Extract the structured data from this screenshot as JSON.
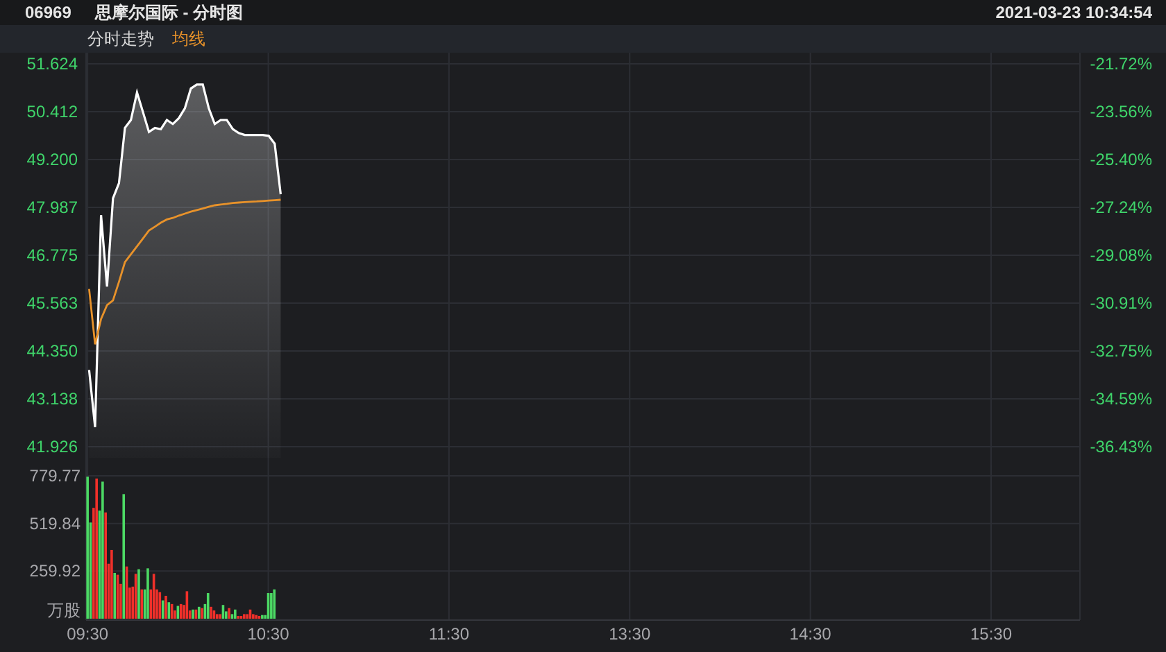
{
  "header": {
    "code": "06969",
    "name": "思摩尔国际 - 分时图",
    "datetime": "2021-03-23 10:34:54"
  },
  "legend": [
    {
      "label": "分时走势",
      "color": "#d8d8d8"
    },
    {
      "label": "均线",
      "color": "#e8922a"
    }
  ],
  "price_chart": {
    "chart_data": {
      "type": "line",
      "grid": true,
      "ylim": [
        41.926,
        51.624
      ],
      "categories": [
        null,
        null,
        null,
        null,
        null,
        null,
        null,
        null,
        null,
        null,
        null,
        null,
        null,
        null,
        null,
        null,
        null,
        null,
        null,
        null,
        null,
        null,
        null,
        null,
        null,
        null,
        null,
        null,
        null,
        null,
        null,
        null,
        null,
        null,
        null,
        null,
        null,
        null,
        null,
        null,
        null,
        null,
        null,
        null,
        null,
        null,
        null,
        null,
        null,
        null,
        null,
        null,
        null,
        null,
        null,
        null,
        null,
        null,
        null,
        null,
        null,
        null,
        null,
        null,
        null,
        null,
        null,
        null,
        null,
        null,
        null,
        null,
        null,
        null,
        null,
        null,
        null,
        null,
        null,
        null,
        null,
        null,
        null,
        null,
        null,
        null,
        null,
        null,
        null,
        null,
        null,
        null,
        null,
        null,
        null,
        null,
        null,
        null,
        null,
        null,
        null,
        null,
        null,
        null,
        null,
        null,
        null,
        null,
        null,
        null,
        null,
        null,
        null,
        null,
        null,
        null,
        null,
        null,
        null,
        null,
        null,
        null,
        null,
        null,
        null,
        null,
        null,
        null,
        null,
        null,
        null,
        null,
        null,
        null,
        null,
        null,
        null,
        null,
        null,
        null,
        null,
        null,
        null,
        null,
        null,
        null,
        null,
        null,
        null,
        null,
        null,
        null,
        null,
        null,
        null,
        null,
        null,
        null,
        null,
        null,
        null,
        null,
        null,
        null,
        null,
        null
      ],
      "yticks": [
        {
          "value": 41.926,
          "label": "41.926"
        },
        {
          "value": 43.138,
          "label": "43.138"
        },
        {
          "value": 44.35,
          "label": "44.350"
        },
        {
          "value": 45.563,
          "label": "45.563"
        },
        {
          "value": 46.775,
          "label": "46.775"
        },
        {
          "value": 47.987,
          "label": "47.987"
        },
        {
          "value": 49.2,
          "label": "49.200"
        },
        {
          "value": 50.412,
          "label": "50.412"
        },
        {
          "value": 51.624,
          "label": "51.624"
        }
      ],
      "series": [
        {
          "color": "#ffffff",
          "values": [
            43.87,
            42.42,
            47.79,
            45.98,
            48.22,
            48.6,
            50.0,
            50.2,
            50.9,
            50.4,
            49.9,
            50.0,
            49.97,
            50.2,
            50.1,
            50.25,
            50.5,
            51.0,
            51.1,
            51.1,
            50.5,
            50.1,
            50.2,
            50.2,
            49.97,
            49.87,
            49.82,
            49.82,
            49.82,
            49.82,
            49.8,
            49.6,
            48.32,
            null,
            null,
            null,
            null,
            null,
            null,
            null,
            null,
            null,
            null,
            null,
            null,
            null,
            null,
            null,
            null,
            null,
            null,
            null,
            null,
            null,
            null,
            null,
            null,
            null,
            null,
            null,
            null,
            null,
            null,
            null,
            null,
            null,
            null,
            null,
            null,
            null,
            null,
            null,
            null,
            null,
            null,
            null,
            null,
            null,
            null,
            null,
            null,
            null,
            null,
            null,
            null,
            null,
            null,
            null,
            null,
            null,
            null,
            null,
            null,
            null,
            null,
            null,
            null,
            null,
            null,
            null,
            null,
            null,
            null,
            null,
            null,
            null,
            null,
            null,
            null,
            null,
            null,
            null,
            null,
            null,
            null,
            null,
            null,
            null,
            null,
            null,
            null,
            null,
            null,
            null,
            null,
            null,
            null,
            null,
            null,
            null,
            null,
            null,
            null,
            null,
            null,
            null,
            null,
            null,
            null,
            null,
            null,
            null,
            null,
            null,
            null,
            null,
            null,
            null,
            null,
            null,
            null,
            null,
            null,
            null,
            null,
            null,
            null,
            null,
            null,
            null,
            null,
            null,
            null,
            null,
            null,
            null
          ]
        },
        {
          "color": "#e8922a",
          "values": [
            45.92,
            44.52,
            45.16,
            45.51,
            45.63,
            46.1,
            46.6,
            46.8,
            47.0,
            47.2,
            47.4,
            47.5,
            47.6,
            47.68,
            47.72,
            47.78,
            47.83,
            47.88,
            47.92,
            47.96,
            48.0,
            48.04,
            48.06,
            48.08,
            48.1,
            48.11,
            48.12,
            48.13,
            48.14,
            48.15,
            48.16,
            48.17,
            48.18,
            null,
            null,
            null,
            null,
            null,
            null,
            null,
            null,
            null,
            null,
            null,
            null,
            null,
            null,
            null,
            null,
            null,
            null,
            null,
            null,
            null,
            null,
            null,
            null,
            null,
            null,
            null,
            null,
            null,
            null,
            null,
            null,
            null,
            null,
            null,
            null,
            null,
            null,
            null,
            null,
            null,
            null,
            null,
            null,
            null,
            null,
            null,
            null,
            null,
            null,
            null,
            null,
            null,
            null,
            null,
            null,
            null,
            null,
            null,
            null,
            null,
            null,
            null,
            null,
            null,
            null,
            null,
            null,
            null,
            null,
            null,
            null,
            null,
            null,
            null,
            null,
            null,
            null,
            null,
            null,
            null,
            null,
            null,
            null,
            null,
            null,
            null,
            null,
            null,
            null,
            null,
            null,
            null,
            null,
            null,
            null,
            null,
            null,
            null,
            null,
            null,
            null,
            null,
            null,
            null,
            null,
            null,
            null,
            null,
            null,
            null,
            null,
            null,
            null,
            null,
            null,
            null,
            null,
            null,
            null,
            null,
            null,
            null,
            null,
            null,
            null,
            null,
            null,
            null,
            null,
            null,
            null,
            null
          ]
        }
      ]
    },
    "percent_labels": [
      "-21.72%",
      "-23.56%",
      "-25.40%",
      "-27.24%",
      "-29.08%",
      "-30.91%",
      "-32.75%",
      "-34.59%",
      "-36.43%"
    ]
  },
  "volume_chart": {
    "chart_data": {
      "type": "bar",
      "grid": true,
      "ylim": [
        0,
        779.77
      ],
      "yticks": [
        259.92,
        519.84,
        779.77
      ],
      "categories": [
        "09:30",
        null,
        null,
        null,
        null,
        null,
        null,
        null,
        null,
        null,
        null,
        null,
        null,
        null,
        null,
        null,
        null,
        null,
        null,
        null,
        null,
        null,
        null,
        null,
        null,
        null,
        null,
        null,
        null,
        null,
        null,
        null,
        null,
        null,
        null,
        null,
        null,
        null,
        null,
        null,
        null,
        null,
        null,
        null,
        null,
        null,
        null,
        null,
        null,
        null,
        null,
        null,
        null,
        null,
        null,
        null,
        null,
        null,
        null,
        null,
        "10:30",
        null,
        null,
        null,
        null,
        null,
        null,
        null,
        null,
        null,
        null,
        null,
        null,
        null,
        null,
        null,
        null,
        null,
        null,
        null,
        null,
        null,
        null,
        null,
        null,
        null,
        null,
        null,
        null,
        null,
        null,
        null,
        null,
        null,
        null,
        null,
        null,
        null,
        null,
        null,
        null,
        null,
        null,
        null,
        null,
        null,
        null,
        null,
        null,
        null,
        null,
        null,
        null,
        null,
        null,
        null,
        null,
        null,
        null,
        null,
        "11:30",
        null,
        null,
        null,
        null,
        null,
        null,
        null,
        null,
        null,
        null,
        null,
        null,
        null,
        null,
        null,
        null,
        null,
        null,
        null,
        null,
        null,
        null,
        null,
        null,
        null,
        null,
        null,
        null,
        null,
        null,
        null,
        null,
        null,
        null,
        null,
        null,
        null,
        null,
        null,
        null,
        null,
        null,
        null,
        null,
        null,
        null,
        null,
        null,
        null,
        null,
        null,
        null,
        null,
        null,
        null,
        null,
        null,
        null,
        null,
        "13:30",
        null,
        null,
        null,
        null,
        null,
        null,
        null,
        null,
        null,
        null,
        null,
        null,
        null,
        null,
        null,
        null,
        null,
        null,
        null,
        null,
        null,
        null,
        null,
        null,
        null,
        null,
        null,
        null,
        null,
        null,
        null,
        null,
        null,
        null,
        null,
        null,
        null,
        null,
        null,
        null,
        null,
        null,
        null,
        null,
        null,
        null,
        null,
        null,
        null,
        null,
        null,
        null,
        null,
        null,
        null,
        null,
        null,
        null,
        null,
        "14:30",
        null,
        null,
        null,
        null,
        null,
        null,
        null,
        null,
        null,
        null,
        null,
        null,
        null,
        null,
        null,
        null,
        null,
        null,
        null,
        null,
        null,
        null,
        null,
        null,
        null,
        null,
        null,
        null,
        null,
        null,
        null,
        null,
        null,
        null,
        null,
        null,
        null,
        null,
        null,
        null,
        null,
        null,
        null,
        null,
        null,
        null,
        null,
        null,
        null,
        null,
        null,
        null,
        null,
        null,
        null,
        null,
        null,
        null,
        null,
        "15:30",
        null,
        null,
        null,
        null,
        null,
        null,
        null,
        null,
        null,
        null,
        null,
        null,
        null,
        null,
        null,
        null,
        null,
        null,
        null,
        null,
        null,
        null,
        null,
        null,
        null,
        null,
        null,
        null,
        null
      ],
      "series": [
        {
          "color": "#4cd964",
          "values": [
            775,
            525,
            null,
            null,
            590,
            748,
            null,
            null,
            null,
            250,
            null,
            null,
            680,
            null,
            null,
            null,
            null,
            270,
            null,
            160,
            275,
            null,
            null,
            null,
            null,
            100,
            null,
            90,
            null,
            null,
            70,
            null,
            null,
            null,
            null,
            50,
            null,
            65,
            null,
            80,
            140,
            null,
            null,
            null,
            null,
            75,
            40,
            null,
            25,
            50,
            null,
            null,
            null,
            null,
            null,
            null,
            null,
            null,
            20,
            20,
            140,
            140,
            160,
            null,
            null,
            null,
            null,
            null,
            null,
            null,
            null,
            null,
            null,
            null,
            null,
            null,
            null,
            null,
            null,
            null,
            null,
            null,
            null,
            null,
            null,
            null,
            null,
            null,
            null,
            null,
            null,
            null,
            null,
            null,
            null,
            null,
            null,
            null,
            null,
            null,
            null,
            null,
            null,
            null,
            null,
            null,
            null,
            null,
            null,
            null,
            null,
            null,
            null,
            null,
            null,
            null,
            null,
            null,
            null,
            null,
            null,
            null,
            null,
            null,
            null,
            null,
            null,
            null,
            null,
            null,
            null,
            null,
            null,
            null,
            null,
            null,
            null,
            null,
            null,
            null,
            null,
            null,
            null,
            null,
            null,
            null,
            null,
            null,
            null,
            null,
            null,
            null,
            null,
            null,
            null,
            null,
            null,
            null,
            null,
            null,
            null,
            null,
            null,
            null,
            null,
            null,
            null,
            null,
            null,
            null,
            null,
            null,
            null,
            null,
            null,
            null,
            null,
            null,
            null,
            null,
            null,
            null,
            null,
            null,
            null,
            null,
            null,
            null,
            null,
            null,
            null,
            null,
            null,
            null,
            null,
            null,
            null,
            null,
            null,
            null,
            null,
            null,
            null,
            null,
            null,
            null,
            null,
            null,
            null,
            null,
            null,
            null,
            null,
            null,
            null,
            null,
            null,
            null,
            null,
            null,
            null,
            null,
            null,
            null,
            null,
            null,
            null,
            null,
            null,
            null,
            null,
            null,
            null,
            null,
            null,
            null,
            null,
            null,
            null,
            null,
            null,
            null,
            null,
            null,
            null,
            null,
            null,
            null,
            null,
            null,
            null,
            null,
            null,
            null,
            null,
            null,
            null,
            null,
            null,
            null,
            null,
            null,
            null,
            null,
            null,
            null,
            null,
            null,
            null,
            null,
            null,
            null,
            null,
            null,
            null,
            null,
            null,
            null,
            null,
            null,
            null,
            null,
            null,
            null,
            null,
            null,
            null,
            null,
            null,
            null,
            null,
            null,
            null,
            null,
            null,
            null,
            null,
            null,
            null,
            null,
            null,
            null,
            null,
            null,
            null,
            null,
            null,
            null,
            null,
            null,
            null,
            null,
            null,
            null,
            null,
            null,
            null,
            null,
            null,
            null,
            null,
            null,
            null,
            null,
            null,
            null,
            null,
            null,
            null,
            null
          ]
        },
        {
          "color": "#f0302a",
          "values": [
            null,
            null,
            605,
            765,
            null,
            null,
            580,
            300,
            375,
            null,
            240,
            190,
            null,
            285,
            170,
            175,
            245,
            null,
            160,
            null,
            null,
            160,
            245,
            160,
            145,
            null,
            125,
            null,
            80,
            45,
            null,
            80,
            75,
            150,
            45,
            null,
            50,
            null,
            58,
            null,
            null,
            65,
            45,
            25,
            25,
            null,
            null,
            58,
            null,
            null,
            15,
            15,
            25,
            25,
            50,
            25,
            20,
            15,
            null,
            null,
            null,
            null,
            null,
            null,
            null,
            null,
            null,
            null,
            null,
            null,
            null,
            null,
            null,
            null,
            null,
            null,
            null,
            null,
            null,
            null,
            null,
            null,
            null,
            null,
            null,
            null,
            null,
            null,
            null,
            null,
            null,
            null,
            null,
            null,
            null,
            null,
            null,
            null,
            null,
            null,
            null,
            null,
            null,
            null,
            null,
            null,
            null,
            null,
            null,
            null,
            null,
            null,
            null,
            null,
            null,
            null,
            null,
            null,
            null,
            null,
            null,
            null,
            null,
            null,
            null,
            null,
            null,
            null,
            null,
            null,
            null,
            null,
            null,
            null,
            null,
            null,
            null,
            null,
            null,
            null,
            null,
            null,
            null,
            null,
            null,
            null,
            null,
            null,
            null,
            null,
            null,
            null,
            null,
            null,
            null,
            null,
            null,
            null,
            null,
            null,
            null,
            null,
            null,
            null,
            null,
            null,
            null,
            null,
            null,
            null,
            null,
            null,
            null,
            null,
            null,
            null,
            null,
            null,
            null,
            null,
            null,
            null,
            null,
            null,
            null,
            null,
            null,
            null,
            null,
            null,
            null,
            null,
            null,
            null,
            null,
            null,
            null,
            null,
            null,
            null,
            null,
            null,
            null,
            null,
            null,
            null,
            null,
            null,
            null,
            null,
            null,
            null,
            null,
            null,
            null,
            null,
            null,
            null,
            null,
            null,
            null,
            null,
            null,
            null,
            null,
            null,
            null,
            null,
            null,
            null,
            null,
            null,
            null,
            null,
            null,
            null,
            null,
            null,
            null,
            null,
            null,
            null,
            null,
            null,
            null,
            null,
            null,
            null,
            null,
            null,
            null,
            null,
            null,
            null,
            null,
            null,
            null,
            null,
            null,
            null,
            null,
            null,
            null,
            null,
            null,
            null,
            null,
            null,
            null,
            null,
            null,
            null,
            null,
            null,
            null,
            null,
            null,
            null,
            null,
            null,
            null,
            null,
            null,
            null,
            null,
            null,
            null,
            null,
            null,
            null,
            null,
            null,
            null,
            null,
            null,
            null,
            null,
            null,
            null,
            null,
            null,
            null,
            null,
            null,
            null,
            null,
            null,
            null,
            null,
            null,
            null,
            null,
            null,
            null,
            null,
            null,
            null,
            null,
            null,
            null,
            null,
            null,
            null,
            null,
            null,
            null,
            null,
            null,
            null,
            null
          ]
        }
      ]
    },
    "unit": "万股"
  }
}
